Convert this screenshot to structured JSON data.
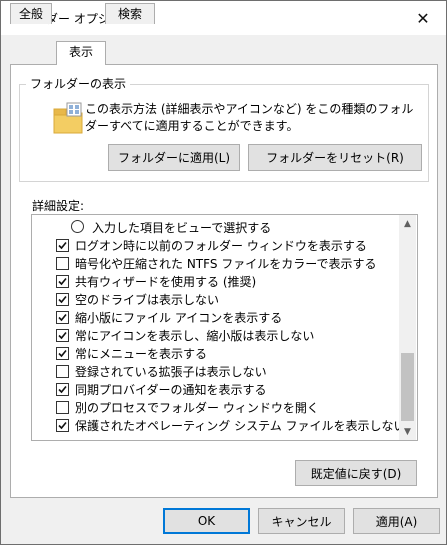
{
  "window": {
    "title": "フォルダー オプション",
    "close_glyph": "✕"
  },
  "tabs": [
    {
      "label": "全般",
      "active": false
    },
    {
      "label": "表示",
      "active": true
    },
    {
      "label": "検索",
      "active": false
    }
  ],
  "folder_view": {
    "title": "フォルダーの表示",
    "description": "この表示方法 (詳細表示やアイコンなど) をこの種類のフォルダーすべてに適用することができます。",
    "apply_button": "フォルダーに適用(L)",
    "reset_button": "フォルダーをリセット(R)"
  },
  "advanced": {
    "title": "詳細設定:",
    "items": [
      {
        "type": "radio",
        "label": "入力した項目をビューで選択する",
        "checked": false
      },
      {
        "type": "checkbox",
        "label": "ログオン時に以前のフォルダー ウィンドウを表示する",
        "checked": true
      },
      {
        "type": "checkbox",
        "label": "暗号化や圧縮された NTFS ファイルをカラーで表示する",
        "checked": false
      },
      {
        "type": "checkbox",
        "label": "共有ウィザードを使用する (推奨)",
        "checked": true
      },
      {
        "type": "checkbox",
        "label": "空のドライブは表示しない",
        "checked": true
      },
      {
        "type": "checkbox",
        "label": "縮小版にファイル アイコンを表示する",
        "checked": true
      },
      {
        "type": "checkbox",
        "label": "常にアイコンを表示し、縮小版は表示しない",
        "checked": true
      },
      {
        "type": "checkbox",
        "label": "常にメニューを表示する",
        "checked": true
      },
      {
        "type": "checkbox",
        "label": "登録されている拡張子は表示しない",
        "checked": false
      },
      {
        "type": "checkbox",
        "label": "同期プロバイダーの通知を表示する",
        "checked": true
      },
      {
        "type": "checkbox",
        "label": "別のプロセスでフォルダー ウィンドウを開く",
        "checked": false
      },
      {
        "type": "checkbox",
        "label": "保護されたオペレーティング システム ファイルを表示しない (推奨)",
        "checked": true
      }
    ],
    "restore_button": "既定値に戻す(D)"
  },
  "footer": {
    "ok": "OK",
    "cancel": "キャンセル",
    "apply": "適用(A)"
  },
  "colors": {
    "accent": "#0078d7",
    "folder": "#f3cd63"
  }
}
